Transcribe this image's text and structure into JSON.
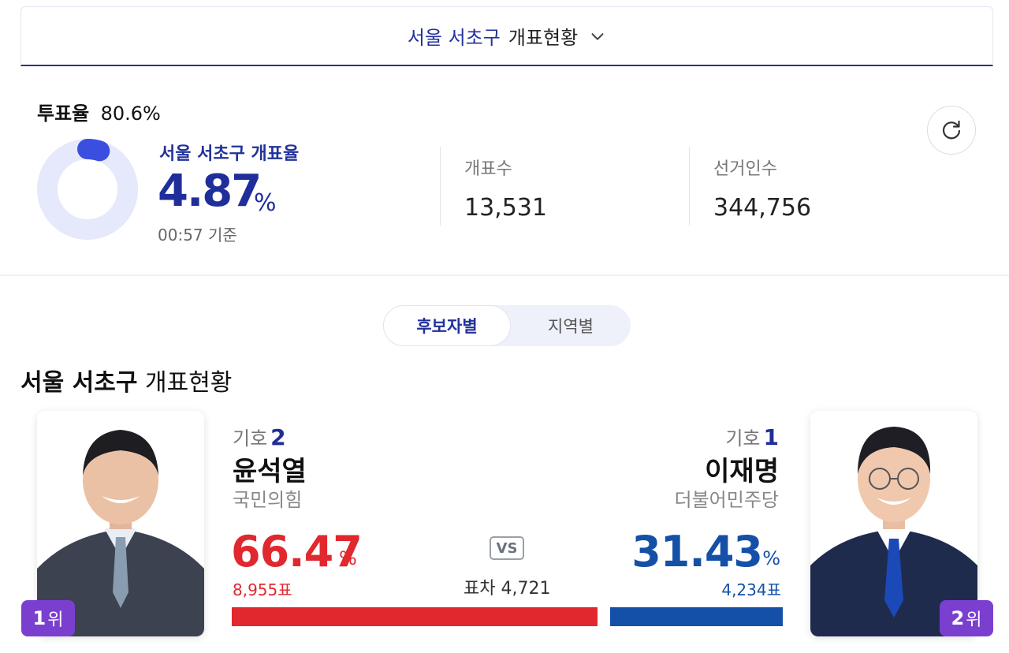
{
  "region_selector": {
    "region": "서울 서초구",
    "suffix": "개표현황"
  },
  "turnout": {
    "label": "투표율",
    "value": "80.6%"
  },
  "count_rate": {
    "label": "서울 서초구 개표율",
    "value": "4.87",
    "unit": "%",
    "progress_percent": 4.87,
    "as_of": "00:57 기준"
  },
  "stats": [
    {
      "label": "개표수",
      "value": "13,531"
    },
    {
      "label": "선거인수",
      "value": "344,756"
    }
  ],
  "tabs": [
    {
      "label": "후보자별",
      "active": true
    },
    {
      "label": "지역별",
      "active": false
    }
  ],
  "section": {
    "region": "서울 서초구",
    "suffix": "개표현황"
  },
  "candidates": {
    "left": {
      "number_label": "기호",
      "number": "2",
      "name": "윤석열",
      "party": "국민의힘",
      "percent": "66.47",
      "percent_unit": "%",
      "votes": "8,955표",
      "rank": "1",
      "rank_unit": "위",
      "share": 66.47,
      "color": "#e0282e"
    },
    "right": {
      "number_label": "기호",
      "number": "1",
      "name": "이재명",
      "party": "더불어민주당",
      "percent": "31.43",
      "percent_unit": "%",
      "votes": "4,234표",
      "rank": "2",
      "rank_unit": "위",
      "share": 31.43,
      "color": "#1450a8"
    }
  },
  "comparison": {
    "vs": "VS",
    "gap_label": "표차",
    "gap_value": "4,721"
  },
  "colors": {
    "brand": "#22319a",
    "rank_badge": "#7b3fd0",
    "donut_track": "#e6e8fb",
    "donut_fill": "#3a4fe0"
  }
}
